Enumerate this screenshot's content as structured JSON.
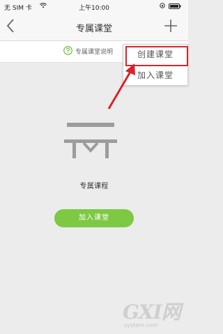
{
  "status_bar": {
    "carrier": "无 SIM 卡",
    "time": "上午10:00"
  },
  "nav": {
    "title": "专属课堂"
  },
  "notice": {
    "text": "专属课堂说明"
  },
  "empty_state": {
    "text": "专属课程"
  },
  "main_button": {
    "label": "加入课堂"
  },
  "dropdown": {
    "items": [
      {
        "label": "创建课堂"
      },
      {
        "label": "加入课堂"
      }
    ]
  },
  "watermark": {
    "logo": "GXI网",
    "sub": "system.com"
  },
  "colors": {
    "accent_green": "#7dc943",
    "highlight_red": "#d8232a",
    "background": "#ececec"
  }
}
